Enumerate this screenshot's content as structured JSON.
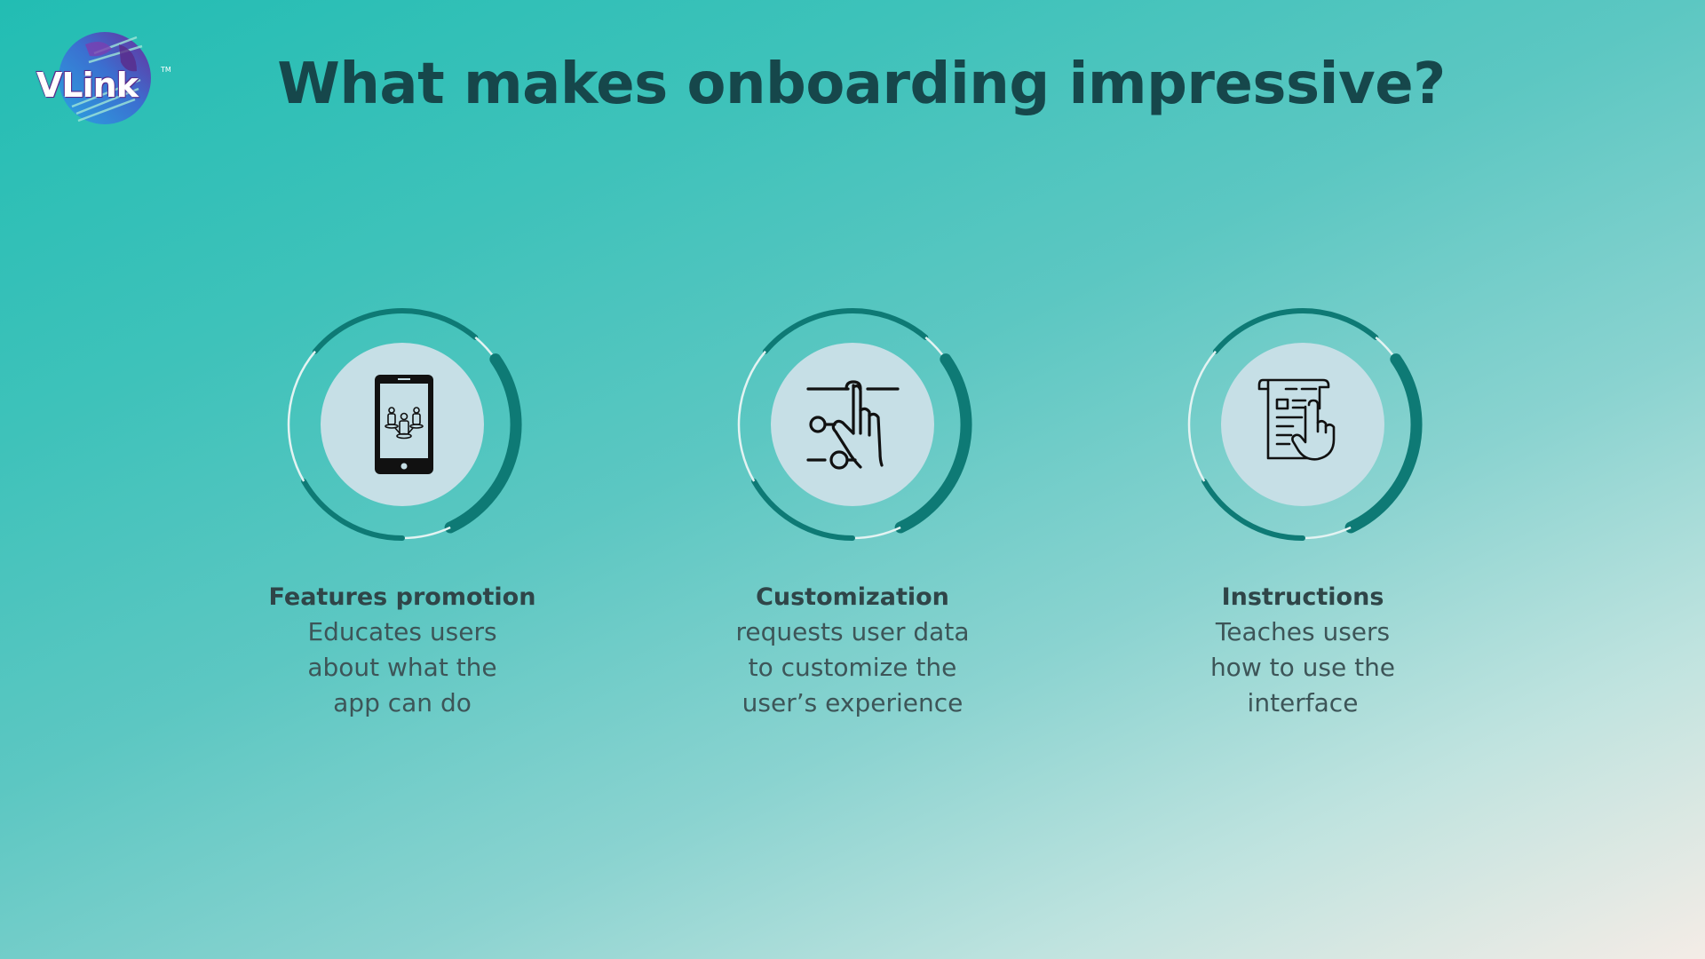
{
  "brand": {
    "logo_text": "VLink",
    "trademark": "TM"
  },
  "title": "What makes onboarding impressive?",
  "colors": {
    "title": "#16474b",
    "ring_dark": "#0e7a75",
    "ring_light": "#e3f3f2",
    "inner_circle": "#c6dfe6",
    "text": "#3d5558"
  },
  "cards": [
    {
      "title": "Features promotion",
      "icon": "smartphone-users-icon",
      "description_lines": [
        "Educates users",
        "about what the",
        "app can do"
      ]
    },
    {
      "title": "Customization",
      "icon": "slider-hand-icon",
      "description_lines": [
        "requests user data",
        "to customize the",
        "user’s experience"
      ]
    },
    {
      "title": "Instructions",
      "icon": "document-hand-icon",
      "description_lines": [
        "Teaches users",
        "how to use the",
        "interface"
      ]
    }
  ]
}
